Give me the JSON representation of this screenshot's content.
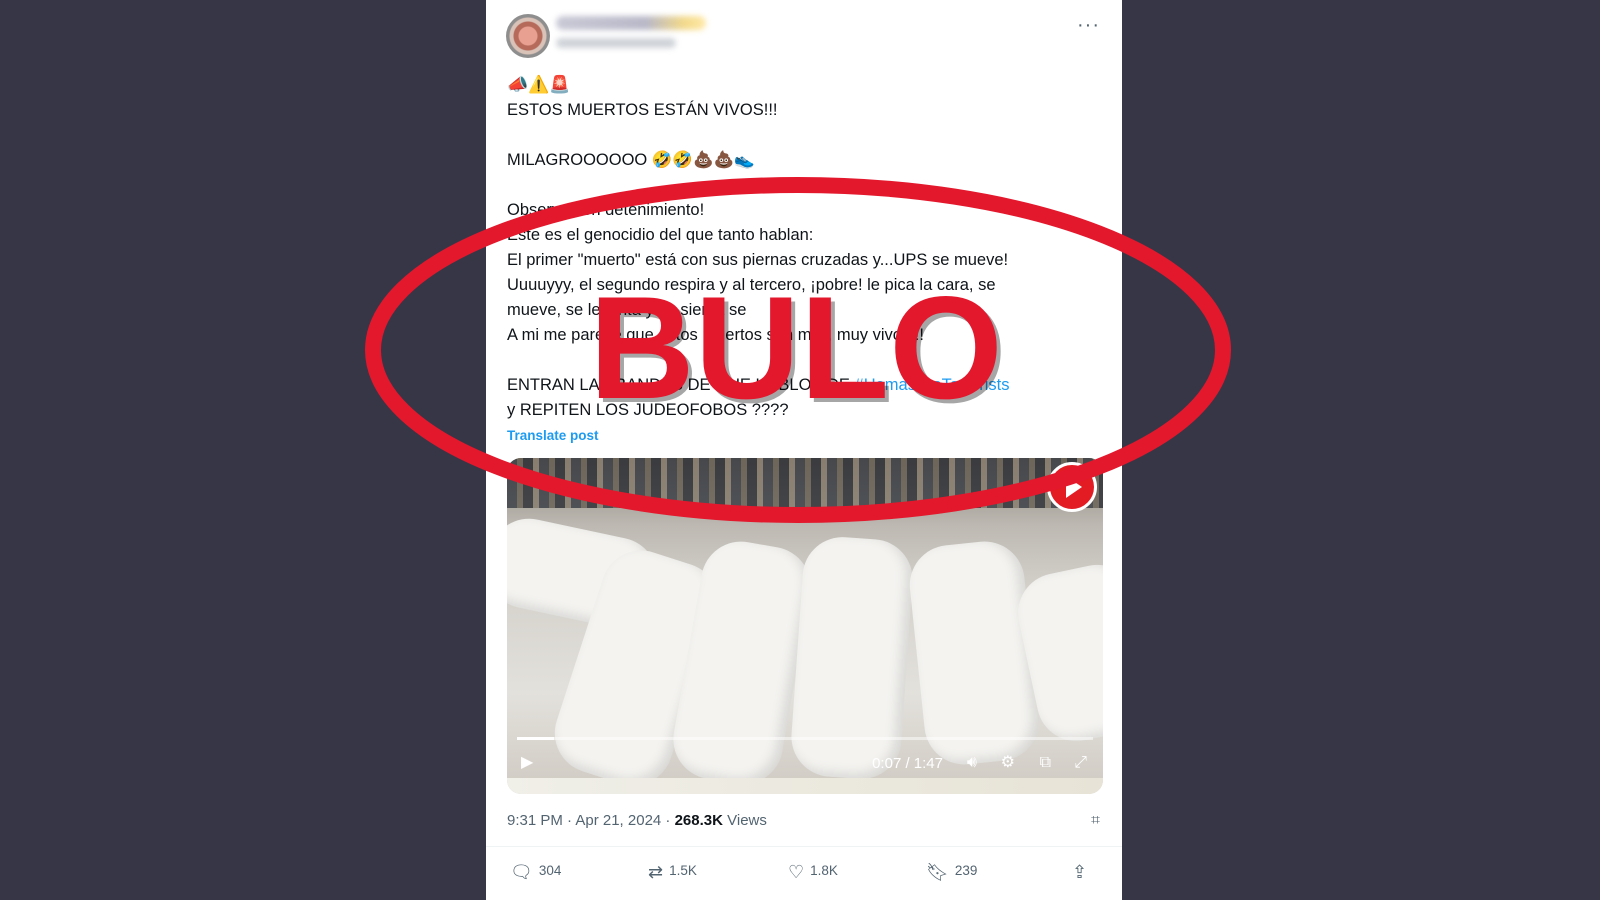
{
  "post": {
    "more_label": "···",
    "emoji_header": "📣⚠️🚨",
    "line1": "ESTOS MUERTOS ESTÁN  VIVOS!!!",
    "line2": "MILAGROOOOOO 🤣🤣💩💩👟",
    "body": [
      "Observa con detenimiento!",
      "Este es el genocidio del que tanto hablan:",
      "El primer \"muerto\" está con sus piernas cruzadas y...UPS se mueve!",
      "Uuuuyyy, el segundo respira y al tercero, ¡pobre! le pica la cara, se",
      "mueve, se levanta y se sienta se",
      "A mi me parece que estos muertos son muy, muy vivos!!!"
    ],
    "last_line_a": "ENTRAN LAS BANDAS DE QUE HABLOS DE",
    "hashtag": "#HamasAreTerrorists",
    "last_line_b": "y REPITEN LOS JUDEOFOBOS ????",
    "translate_label": "Translate post"
  },
  "video": {
    "time": "0:07 / 1:47",
    "progress": 0.065,
    "play_icon": "play-icon",
    "volume_icon": "volume-icon",
    "settings_icon": "gear-icon",
    "pip_icon": "pip-icon",
    "fullscreen_icon": "fullscreen-icon"
  },
  "meta": {
    "timestamp": "9:31 PM · Apr 21, 2024 · ",
    "views_count": "268.3K",
    "views_label": " Views"
  },
  "actions": {
    "replies": "304",
    "reposts": "1.5K",
    "likes": "1.8K",
    "bookmarks": "239"
  },
  "overlay": {
    "stamp_text": "BULO",
    "stamp_color": "#e3182d"
  }
}
